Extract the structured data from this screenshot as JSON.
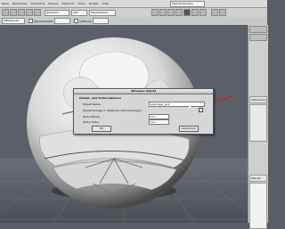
{
  "menubar": {
    "items": [
      "Datei",
      "Bearbeiten",
      "Geometrie",
      "Ebenen",
      "Einblend.",
      "Extra",
      "Fenster",
      "Hilfe"
    ],
    "mode_selector": "Standardmodus"
  },
  "toolbar1": {
    "fields": [
      "Rechteck",
      "Alle",
      "Objektebene"
    ]
  },
  "toolbar2": {
    "fields": [
      "Mittelpunkt",
      "Weichauswahl",
      "Glättung"
    ]
  },
  "right_panel": {
    "labels": [
      "Materialien",
      "Ebenen"
    ]
  },
  "dialog": {
    "title": "Aktuelles Objekt",
    "heading": "Modell- und Texturoptionen",
    "name_label": "Objekt-Name",
    "name_value": "wallkugel_ob4",
    "checkbox_label": "Wiederanzeige in Weblinks (Verknüpfungen)",
    "width_label": "Textur-Breite",
    "width_value": "512",
    "height_label": "Textur-Höhe",
    "height_value": "512",
    "ok_label": "OK",
    "cancel_label": "Abbrechen"
  },
  "colors": {
    "background": "#5a5f66",
    "dialog_bg": "#d6d6d6",
    "red_arrow": "#d11a1a"
  }
}
